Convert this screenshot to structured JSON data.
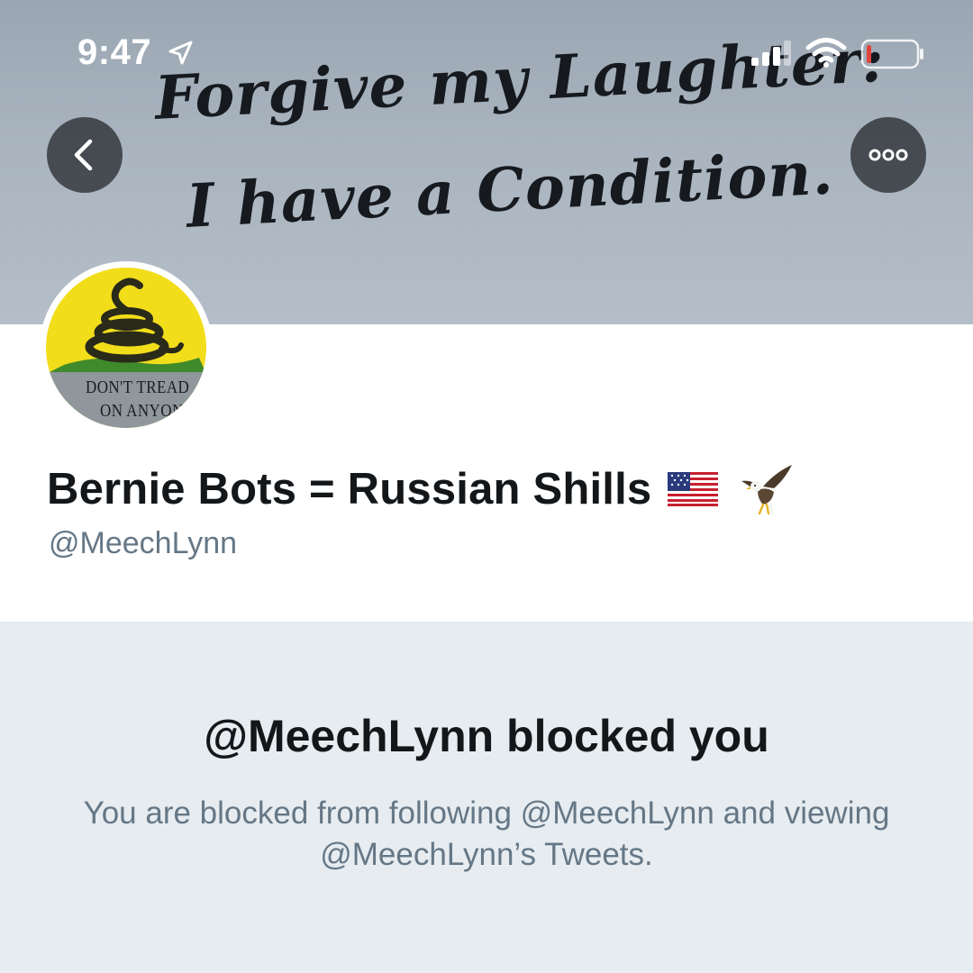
{
  "status_bar": {
    "time": "9:47",
    "icons": [
      "location-arrow-icon",
      "cellular-signal-icon",
      "wifi-icon",
      "battery-low-icon"
    ],
    "battery_color": "#e0443a"
  },
  "banner": {
    "line1": "Forgive my Laughter:",
    "line2": "I have a Condition."
  },
  "nav": {
    "back_icon": "chevron-left-icon",
    "more_icon": "ellipsis-icon"
  },
  "avatar": {
    "line1": "DON'T TREAD",
    "line2": "ON ANYONE",
    "colors": {
      "background": "#f2dd1a",
      "snake": "#2a2a1a",
      "grass": "#3f8a2a",
      "banner": "#8f969c"
    }
  },
  "profile": {
    "display_name": "Bernie Bots = Russian Shills",
    "name_emojis": [
      "us-flag-icon",
      "eagle-icon"
    ],
    "handle": "@MeechLynn"
  },
  "blocked": {
    "title": "@MeechLynn blocked you",
    "description": "You are blocked from following @MeechLynn and viewing @MeechLynn’s Tweets."
  },
  "colors": {
    "primary_text": "#14171a",
    "secondary_text": "#657786",
    "page_background": "#e6ecf0"
  }
}
